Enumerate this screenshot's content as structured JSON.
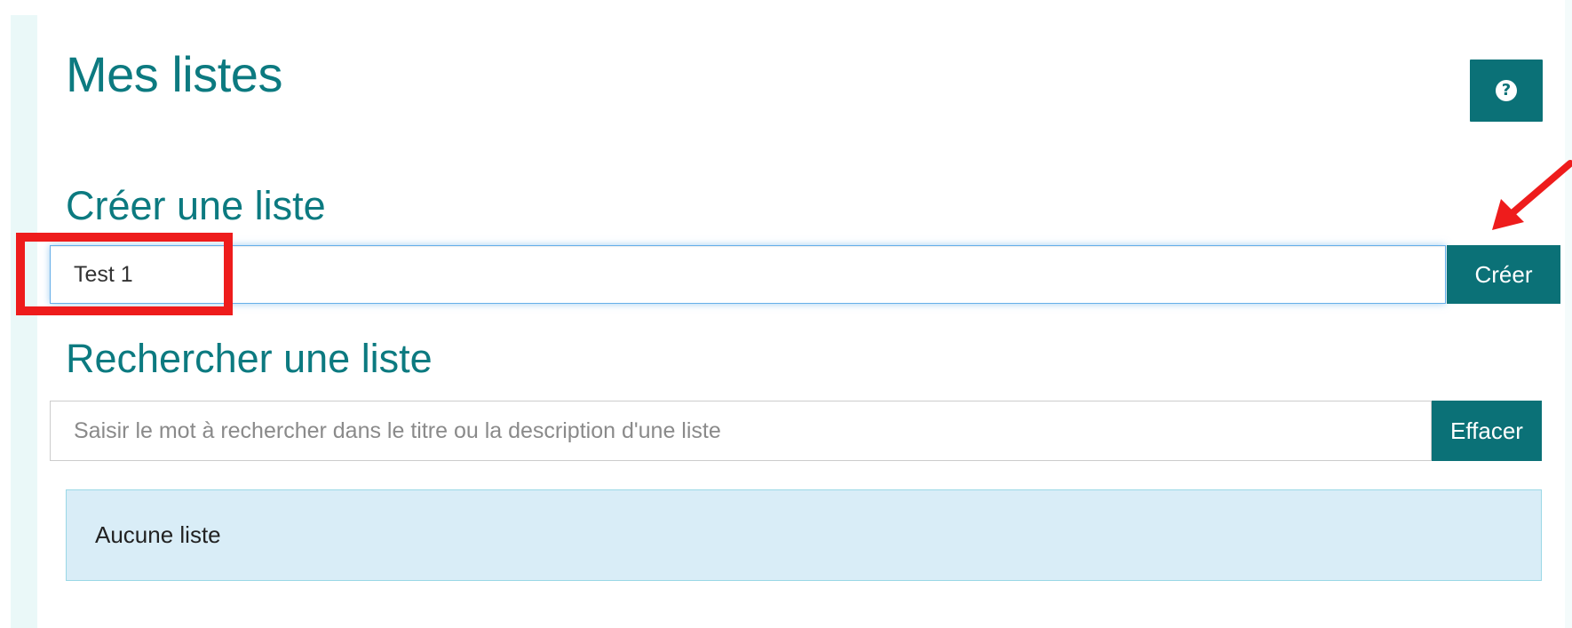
{
  "header": {
    "title": "Mes listes",
    "help_icon": "question-circle-icon",
    "help_glyph": "?"
  },
  "create": {
    "heading": "Créer une liste",
    "input_value": "Test 1",
    "button_label": "Créer"
  },
  "search": {
    "heading": "Rechercher une liste",
    "placeholder": "Saisir le mot à rechercher dans le titre ou la description d'une liste",
    "button_label": "Effacer"
  },
  "results": {
    "empty_message": "Aucune liste"
  },
  "annotations": {
    "highlight_color": "#ee1c1c",
    "arrow_color": "#ee1c1c"
  },
  "colors": {
    "accent": "#0b7177",
    "heading": "#0c7a80",
    "alert_bg": "#d9edf7"
  }
}
